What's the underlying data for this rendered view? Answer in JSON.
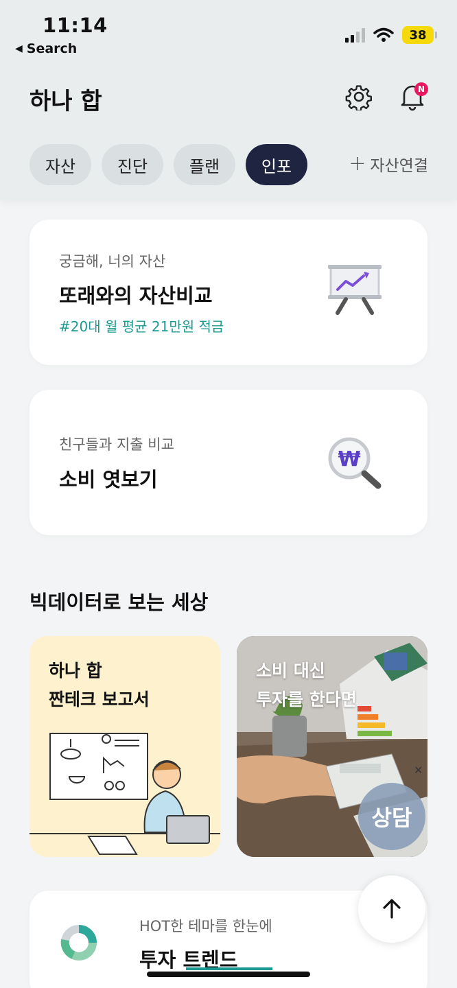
{
  "status": {
    "time": "11:14",
    "back_label": "Search",
    "battery": "38"
  },
  "header": {
    "title": "하나 합",
    "notification_badge": "N"
  },
  "tabs": [
    {
      "label": "자산"
    },
    {
      "label": "진단"
    },
    {
      "label": "플랜"
    },
    {
      "label": "인포"
    }
  ],
  "connect_label": "자산연결",
  "cards": {
    "compare": {
      "subtitle": "궁금해, 너의 자산",
      "title": "또래와의 자산비교",
      "tag": "#20대 월 평균 21만원 적금"
    },
    "spending": {
      "subtitle": "친구들과 지출 비교",
      "title": "소비 엿보기"
    }
  },
  "section": {
    "title": "빅데이터로 보는 세상"
  },
  "tiles": {
    "report": {
      "line1": "하나 합",
      "line2": "짠테크 보고서"
    },
    "invest": {
      "line1": "소비 대신",
      "line2": "투자를 한다면"
    }
  },
  "consult_label": "상담",
  "trend": {
    "subtitle": "HOT한 테마를 한눈에",
    "title": "투자 트렌드"
  },
  "colors": {
    "active_tab": "#1f2540",
    "accent": "#1b9a91",
    "badge": "#e8185e"
  }
}
